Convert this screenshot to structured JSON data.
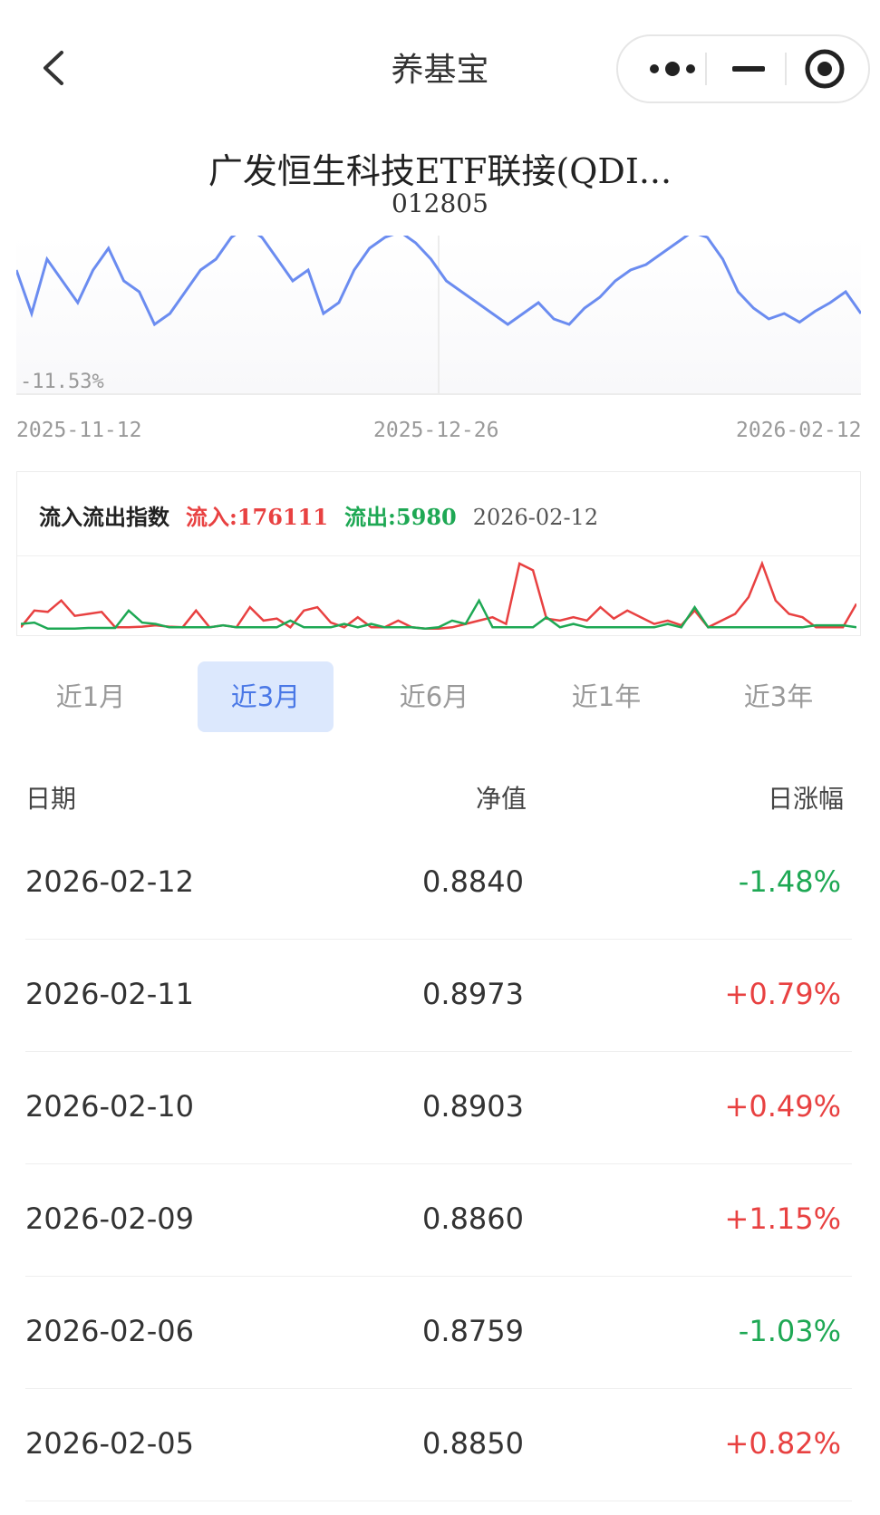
{
  "header": {
    "title": "养基宝"
  },
  "fund": {
    "name": "广发恒生科技ETF联接(QDI...",
    "code": "012805"
  },
  "nav_chart": {
    "min_label": "-11.53%",
    "x_labels": [
      "2025-11-12",
      "2025-12-26",
      "2026-02-12"
    ],
    "line_color": "#6b8cf0"
  },
  "flow": {
    "title": "流入流出指数",
    "inflow_label": "流入:176111",
    "outflow_label": "流出:5980",
    "date": "2026-02-12",
    "inflow_color": "#e84141",
    "outflow_color": "#1ea854"
  },
  "chart_data": [
    {
      "type": "line",
      "title": "",
      "xlabel": "",
      "ylabel": "",
      "x": [
        "2025-11-12",
        "2025-12-26",
        "2026-02-12"
      ],
      "y_min_label": "-11.53%",
      "series": [
        {
          "values": [
            0.6,
            0.2,
            0.7,
            0.5,
            0.3,
            0.6,
            0.8,
            0.5,
            0.4,
            0.1,
            0.2,
            0.4,
            0.6,
            0.7,
            0.9,
            1.0,
            0.9,
            0.7,
            0.5,
            0.6,
            0.2,
            0.3,
            0.6,
            0.8,
            0.9,
            0.95,
            0.85,
            0.7,
            0.5,
            0.4,
            0.3,
            0.2,
            0.1,
            0.2,
            0.3,
            0.15,
            0.1,
            0.25,
            0.35,
            0.5,
            0.6,
            0.65,
            0.75,
            0.85,
            0.95,
            0.9,
            0.7,
            0.4,
            0.25,
            0.15,
            0.2,
            0.12,
            0.22,
            0.3,
            0.4,
            0.2
          ]
        }
      ]
    },
    {
      "type": "line",
      "title": "流入流出指数",
      "xlabel": "",
      "ylabel": "",
      "series": [
        {
          "name": "流入",
          "values": [
            5,
            30,
            28,
            45,
            22,
            25,
            28,
            5,
            5,
            6,
            8,
            6,
            5,
            30,
            5,
            8,
            5,
            35,
            15,
            18,
            5,
            30,
            35,
            12,
            5,
            20,
            5,
            5,
            15,
            5,
            3,
            3,
            5,
            10,
            15,
            20,
            10,
            100,
            90,
            18,
            15,
            20,
            15,
            35,
            18,
            30,
            20,
            10,
            15,
            8,
            30,
            5,
            15,
            25,
            50,
            100,
            45,
            25,
            20,
            5,
            5,
            5,
            40
          ]
        },
        {
          "name": "流出",
          "values": [
            10,
            12,
            3,
            3,
            3,
            4,
            4,
            4,
            30,
            12,
            10,
            5,
            5,
            5,
            5,
            8,
            5,
            5,
            5,
            5,
            15,
            5,
            5,
            5,
            10,
            5,
            10,
            5,
            5,
            5,
            3,
            5,
            15,
            10,
            45,
            5,
            5,
            5,
            5,
            20,
            5,
            10,
            5,
            5,
            5,
            5,
            5,
            5,
            10,
            5,
            35,
            5,
            5,
            5,
            5,
            5,
            5,
            5,
            5,
            8,
            8,
            8,
            5
          ]
        }
      ]
    }
  ],
  "tabs": [
    {
      "label": "近1月",
      "active": false
    },
    {
      "label": "近3月",
      "active": true
    },
    {
      "label": "近6月",
      "active": false
    },
    {
      "label": "近1年",
      "active": false
    },
    {
      "label": "近3年",
      "active": false
    }
  ],
  "table": {
    "headers": {
      "date": "日期",
      "nav": "净值",
      "change": "日涨幅"
    },
    "rows": [
      {
        "date": "2026-02-12",
        "nav": "0.8840",
        "change": "-1.48%"
      },
      {
        "date": "2026-02-11",
        "nav": "0.8973",
        "change": "+0.79%"
      },
      {
        "date": "2026-02-10",
        "nav": "0.8903",
        "change": "+0.49%"
      },
      {
        "date": "2026-02-09",
        "nav": "0.8860",
        "change": "+1.15%"
      },
      {
        "date": "2026-02-06",
        "nav": "0.8759",
        "change": "-1.03%"
      },
      {
        "date": "2026-02-05",
        "nav": "0.8850",
        "change": "+0.82%"
      }
    ]
  }
}
